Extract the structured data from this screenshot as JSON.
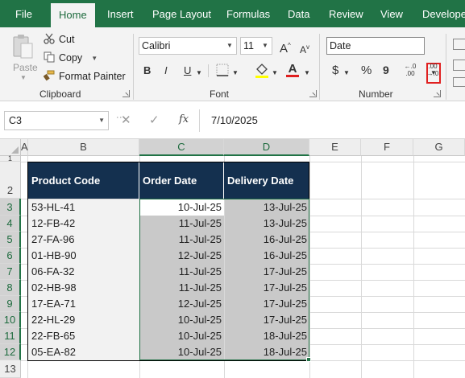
{
  "tabs": [
    "File",
    "Home",
    "Insert",
    "Page Layout",
    "Formulas",
    "Data",
    "Review",
    "View",
    "Developer"
  ],
  "active_tab": "Home",
  "clipboard": {
    "paste_label": "Paste",
    "cut_label": "Cut",
    "copy_label": "Copy",
    "format_painter_label": "Format Painter",
    "group_label": "Clipboard"
  },
  "font": {
    "name": "Calibri",
    "size": "11",
    "group_label": "Font",
    "bold": "B",
    "italic": "I",
    "underline": "U",
    "grow": "A",
    "shrink": "A",
    "color_letter": "A"
  },
  "number": {
    "format": "Date",
    "group_label": "Number",
    "currency": "$",
    "percent": "%",
    "comma": "9",
    "inc_decimal": "←.0 .00",
    "dec_decimal": ".00 →.0"
  },
  "formula_bar": {
    "name_box": "C3",
    "fx": "fx",
    "value": "7/10/2025"
  },
  "columns": [
    "A",
    "B",
    "C",
    "D",
    "E",
    "F",
    "G"
  ],
  "rows": [
    "1",
    "2",
    "3",
    "4",
    "5",
    "6",
    "7",
    "8",
    "9",
    "10",
    "11",
    "12",
    "13"
  ],
  "table": {
    "headers": [
      "Product Code",
      "Order Date",
      "Delivery Date"
    ],
    "rows": [
      [
        "53-HL-41",
        "10-Jul-25",
        "13-Jul-25"
      ],
      [
        "12-FB-42",
        "11-Jul-25",
        "13-Jul-25"
      ],
      [
        "27-FA-96",
        "11-Jul-25",
        "16-Jul-25"
      ],
      [
        "01-HB-90",
        "12-Jul-25",
        "16-Jul-25"
      ],
      [
        "06-FA-32",
        "11-Jul-25",
        "17-Jul-25"
      ],
      [
        "02-HB-98",
        "11-Jul-25",
        "17-Jul-25"
      ],
      [
        "17-EA-71",
        "12-Jul-25",
        "17-Jul-25"
      ],
      [
        "22-HL-29",
        "10-Jul-25",
        "17-Jul-25"
      ],
      [
        "22-FB-65",
        "10-Jul-25",
        "18-Jul-25"
      ],
      [
        "05-EA-82",
        "10-Jul-25",
        "18-Jul-25"
      ]
    ]
  },
  "colors": {
    "ribbon_green": "#217346",
    "header_navy": "#14304f",
    "selection_gray": "#c9c9c9",
    "highlight_red": "#e02020"
  }
}
